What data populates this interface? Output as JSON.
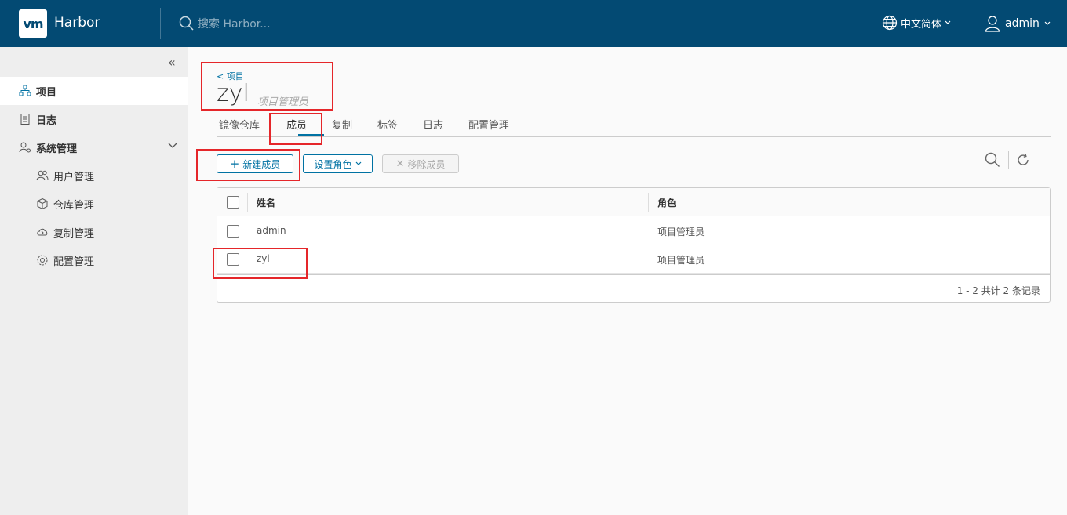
{
  "header": {
    "logo": "vm",
    "brand": "Harbor",
    "search_placeholder": "搜索 Harbor...",
    "language": "中文简体",
    "user": "admin"
  },
  "sidebar": {
    "items": [
      {
        "label": "项目",
        "icon": "projects-icon"
      },
      {
        "label": "日志",
        "icon": "logs-icon"
      },
      {
        "label": "系统管理",
        "icon": "admin-icon"
      },
      {
        "label": "用户管理",
        "icon": "users-icon"
      },
      {
        "label": "仓库管理",
        "icon": "registry-icon"
      },
      {
        "label": "复制管理",
        "icon": "replication-icon"
      },
      {
        "label": "配置管理",
        "icon": "config-icon"
      }
    ]
  },
  "project": {
    "back_label": "< 项目",
    "name": "zyl",
    "role": "项目管理员"
  },
  "tabs": [
    "镜像仓库",
    "成员",
    "复制",
    "标签",
    "日志",
    "配置管理"
  ],
  "toolbar": {
    "new_member": "新建成员",
    "set_role": "设置角色",
    "remove_member": "移除成员"
  },
  "table": {
    "columns": [
      "姓名",
      "角色"
    ],
    "rows": [
      {
        "name": "admin",
        "role": "项目管理员"
      },
      {
        "name": "zyl",
        "role": "项目管理员"
      }
    ],
    "footer": "1 - 2 共计 2 条记录"
  },
  "colors": {
    "header_bg": "#034a73",
    "accent": "#0072a3",
    "annotation": "#e5262a"
  }
}
